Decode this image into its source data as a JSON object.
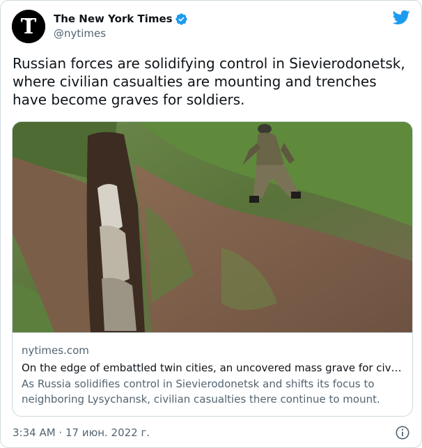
{
  "account": {
    "display_name": "The New York Times",
    "handle": "@nytimes",
    "verified": true
  },
  "tweet": {
    "text": "Russian forces are solidifying control in Sievierodonetsk, where civilian casualties are mounting and trenches have become graves for soldiers."
  },
  "link_card": {
    "domain": "nytimes.com",
    "title": "On the edge of embattled twin cities, an uncovered mass grave for civili…",
    "description": "As Russia solidifies control in Sievierodonetsk and shifts its focus to neighboring Lysychansk, civilian casualties there continue to mount."
  },
  "footer": {
    "timestamp": "3:34 AM · 17 июн. 2022 г."
  },
  "icons": {
    "avatar": "nyt-logo-icon",
    "verified": "verified-badge-icon",
    "platform": "twitter-bird-icon",
    "info": "info-icon"
  },
  "colors": {
    "brand_blue": "#1d9bf0",
    "text_primary": "#0f1419",
    "text_secondary": "#536471",
    "border": "#cfd9de"
  }
}
